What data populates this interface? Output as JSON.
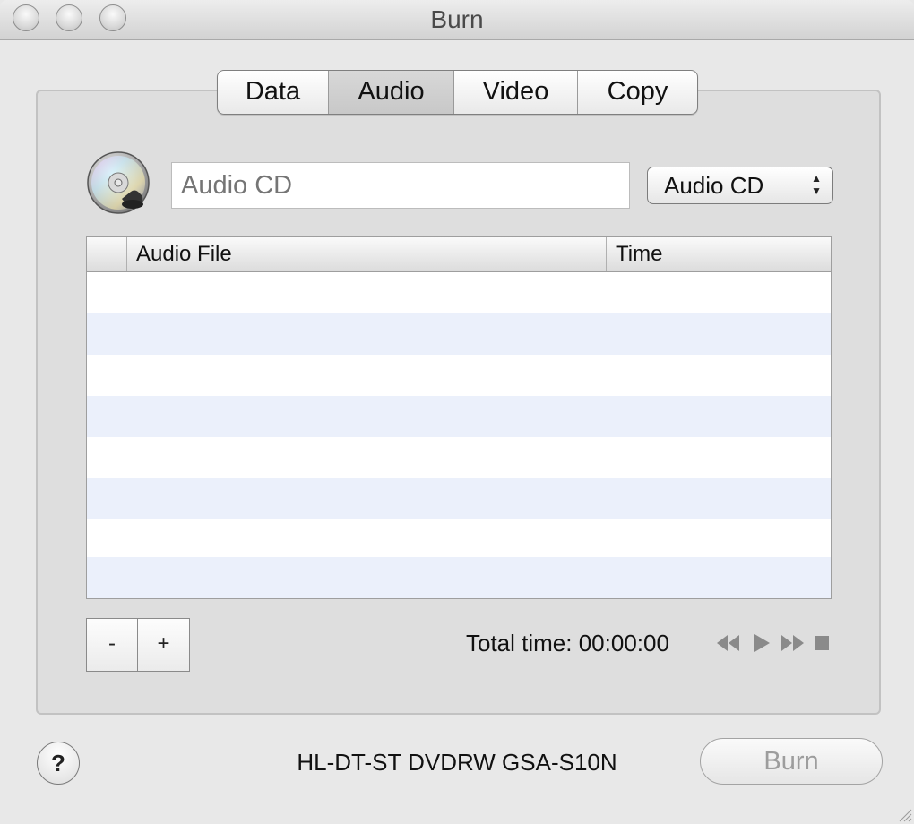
{
  "window": {
    "title": "Burn"
  },
  "tabs": [
    {
      "label": "Data",
      "selected": false
    },
    {
      "label": "Audio",
      "selected": true
    },
    {
      "label": "Video",
      "selected": false
    },
    {
      "label": "Copy",
      "selected": false
    }
  ],
  "disc": {
    "icon": "cd-disc-icon",
    "name_placeholder": "Audio CD",
    "type_popup": {
      "selected": "Audio CD"
    }
  },
  "table": {
    "columns": [
      "",
      "Audio File",
      "Time"
    ],
    "rows": []
  },
  "controls": {
    "remove_label": "-",
    "add_label": "+",
    "total_time": "Total time: 00:00:00"
  },
  "footer": {
    "help_label": "?",
    "drive_name": "HL-DT-ST DVDRW GSA-S10N",
    "burn_label": "Burn"
  },
  "colors": {
    "alt_row": "#ebf0fb",
    "disabled_text": "#9d9d9d"
  }
}
